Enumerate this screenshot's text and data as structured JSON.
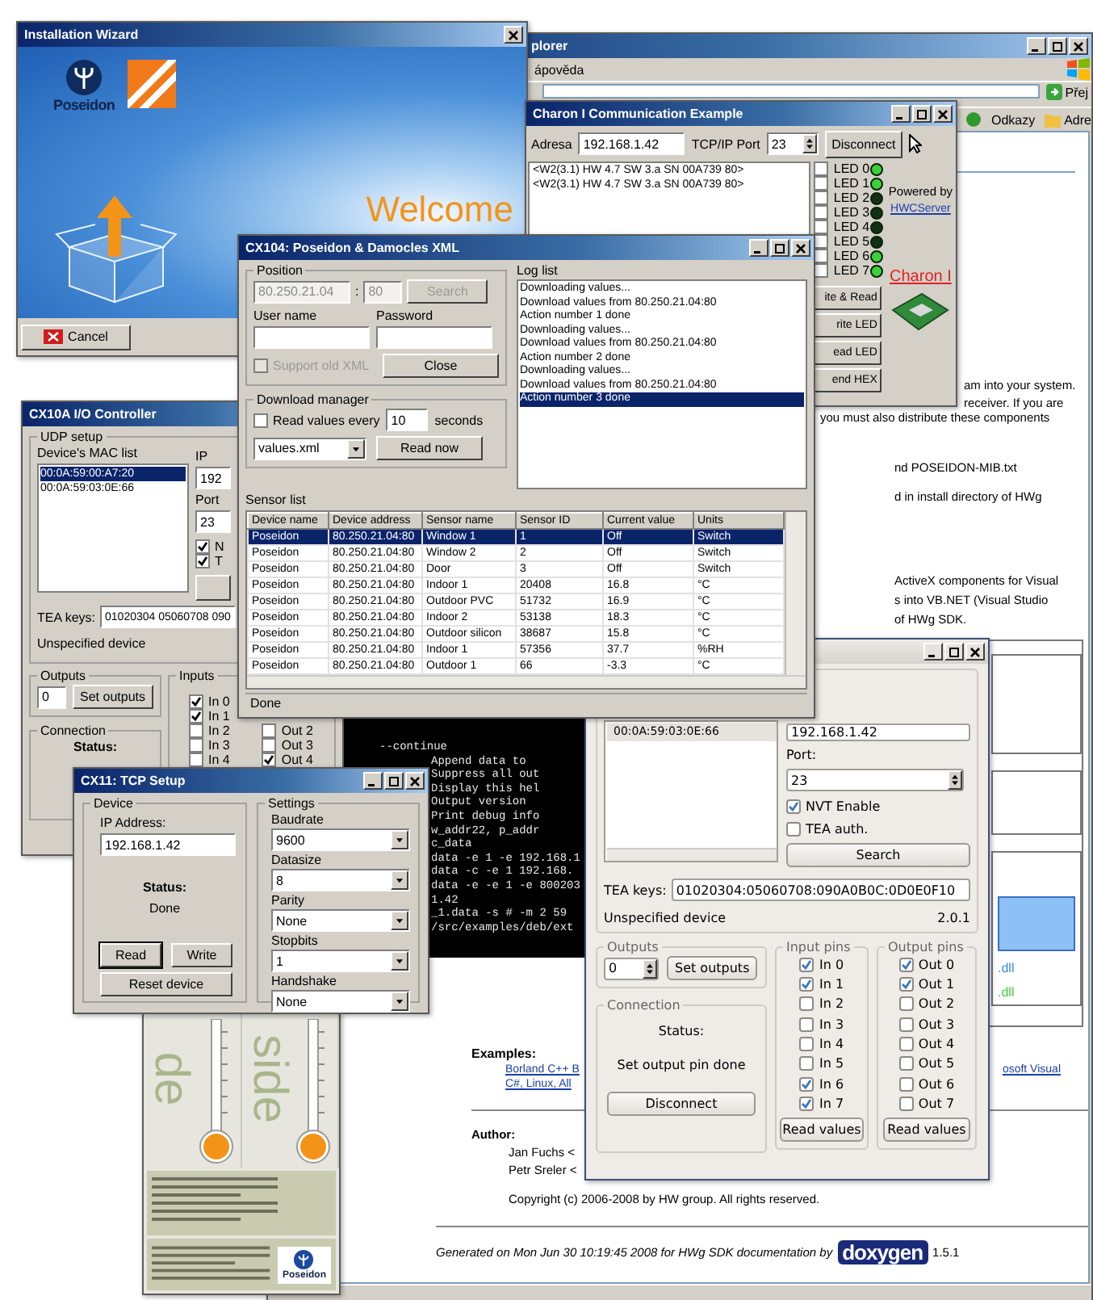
{
  "browser": {
    "title": "plorer",
    "menu": "ápověda",
    "go": "Přej",
    "links_label": "Odkazy",
    "address_label": "Adre",
    "fragments": [
      "am into your system.",
      "receiver. If you are",
      "you must also distribute these components",
      "nd POSEIDON-MIB.txt",
      "d in install directory of HWg",
      "ActiveX components for Visual",
      "s into VB.NET (Visual Studio",
      "of HWg SDK."
    ],
    "dll_labels": [
      {
        "text": ".dll",
        "color": "#3a8ee6"
      },
      {
        "text": ".dll",
        "color": "#3fcf3f"
      }
    ],
    "examples_heading": "Examples:",
    "example_links": [
      "Borland C++ B",
      "osoft Visual",
      "C#, Linux, All"
    ],
    "author_heading": "Author:",
    "authors": [
      "Jan Fuchs <",
      "Petr Sreler <"
    ],
    "copyright": "Copyright (c) 2006-2008 by HW group. All rights reserved.",
    "generated": "Generated on Mon Jun 30 10:19:45 2008 for HWg SDK documentation by",
    "doxygen": "doxygen",
    "doxygen_version": "1.5.1"
  },
  "terminal": {
    "lines": [
      "--continue",
      "Append data to",
      "Suppress all out",
      "Display this hel",
      "Output version",
      "Print debug info",
      "w_addr22, p_addr",
      "c_data",
      "data -e 1 -e 192.168.1",
      "data -c -e 1 192.168.",
      "data -e -e 1 -e 800203",
      "1.42",
      "_1.data -s # -m 2 59",
      "/src/examples/deb/ext"
    ]
  },
  "wizard": {
    "title": "Installation Wizard",
    "brand": "Poseidon",
    "welcome": "Welcome",
    "cancel": "Cancel"
  },
  "charon": {
    "title": "Charon I Communication Example",
    "address_label": "Adresa",
    "address": "192.168.1.42",
    "port_label": "TCP/IP Port",
    "port": "23",
    "disconnect": "Disconnect",
    "log": [
      "<W2(3.1) HW 4.7 SW 3.a SN 00A739 80>",
      "<W2(3.1) HW 4.7 SW 3.a SN 00A739 80>"
    ],
    "leds": [
      {
        "label": "LED 0",
        "checked": false,
        "on": true
      },
      {
        "label": "LED 1",
        "checked": false,
        "on": true
      },
      {
        "label": "LED 2",
        "checked": false,
        "on": false
      },
      {
        "label": "LED 3",
        "checked": false,
        "on": false
      },
      {
        "label": "LED 4",
        "checked": false,
        "on": false
      },
      {
        "label": "LED 5",
        "checked": false,
        "on": false
      },
      {
        "label": "LED 6",
        "checked": false,
        "on": true
      },
      {
        "label": "LED 7",
        "checked": false,
        "on": true
      }
    ],
    "actions": [
      "ite & Read",
      "rite LED",
      "ead LED",
      "end HEX"
    ],
    "powered_by": "Powered by",
    "server_link": "HWCServer",
    "product": "Charon I"
  },
  "io": {
    "title": "CX10A I/O Controller",
    "udp_label": "UDP setup",
    "mac_label": "Device's MAC list",
    "macs": [
      {
        "text": "00:0A:59:00:A7:20",
        "selected": true
      },
      {
        "text": "00:0A:59:03:0E:66",
        "selected": false
      }
    ],
    "ip_label": "IP",
    "ip": "192",
    "port_label": "Port",
    "port": "23",
    "options": [
      {
        "label": "N",
        "checked": true
      },
      {
        "label": "T",
        "checked": true
      }
    ],
    "tea_label": "TEA keys:",
    "tea": "01020304 05060708 090",
    "device": "Unspecified device",
    "outputs_label": "Outputs",
    "outputs": "0",
    "set_outputs": "Set outputs",
    "inputs_label": "Inputs",
    "inputs": [
      {
        "label": "In 0",
        "checked": true
      },
      {
        "label": "In 1",
        "checked": true
      },
      {
        "label": "In 2",
        "checked": false
      },
      {
        "label": "In 3",
        "checked": false
      },
      {
        "label": "In 4",
        "checked": false
      }
    ],
    "outs": [
      {
        "label": "Out 2",
        "checked": false
      },
      {
        "label": "Out 3",
        "checked": false
      },
      {
        "label": "Out 4",
        "checked": true
      }
    ],
    "connection_label": "Connection",
    "status_label": "Status:"
  },
  "qt": {
    "mac": {
      "text": "00:0A:59:03:0E:66",
      "selected": true
    },
    "ip": "192.168.1.42",
    "port_label": "Port:",
    "port": "23",
    "options": [
      {
        "label": "NVT Enable",
        "checked": true
      },
      {
        "label": "TEA auth.",
        "checked": false
      }
    ],
    "search": "Search",
    "tea_label": "TEA keys:",
    "tea": "01020304:05060708:090A0B0C:0D0E0F10",
    "device": "Unspecified device",
    "version": "2.0.1",
    "outputs_label": "Outputs",
    "outputs": "0",
    "set_outputs": "Set outputs",
    "connection_label": "Connection",
    "status_label": "Status:",
    "status": "Set output pin done",
    "disconnect": "Disconnect",
    "input_label": "Input pins",
    "inputs": [
      {
        "label": "In 0",
        "checked": true
      },
      {
        "label": "In 1",
        "checked": true
      },
      {
        "label": "In 2",
        "checked": false
      },
      {
        "label": "In 3",
        "checked": false
      },
      {
        "label": "In 4",
        "checked": false
      },
      {
        "label": "In 5",
        "checked": false
      },
      {
        "label": "In 6",
        "checked": true
      },
      {
        "label": "In 7",
        "checked": true
      }
    ],
    "input_read": "Read values",
    "output_label": "Output pins",
    "output_pins": [
      {
        "label": "Out 0",
        "checked": true
      },
      {
        "label": "Out 1",
        "checked": true
      },
      {
        "label": "Out 2",
        "checked": false
      },
      {
        "label": "Out 3",
        "checked": false
      },
      {
        "label": "Out 4",
        "checked": false
      },
      {
        "label": "Out 5",
        "checked": false
      },
      {
        "label": "Out 6",
        "checked": false
      },
      {
        "label": "Out 7",
        "checked": false
      }
    ],
    "output_read": "Read values"
  },
  "thermometer": {
    "labels": [
      "de",
      "side"
    ],
    "brand": "Poseidon"
  },
  "tcp": {
    "title": "CX11: TCP Setup",
    "device_label": "Device",
    "ip_label": "IP Address:",
    "ip": "192.168.1.42",
    "status_label": "Status:",
    "status": "Done",
    "read": "Read",
    "write": "Write",
    "reset": "Reset device",
    "settings_label": "Settings",
    "settings": [
      {
        "label": "Baudrate",
        "value": "9600"
      },
      {
        "label": "Datasize",
        "value": "8"
      },
      {
        "label": "Parity",
        "value": "None"
      },
      {
        "label": "Stopbits",
        "value": "1"
      },
      {
        "label": "Handshake",
        "value": "None"
      }
    ]
  },
  "xml": {
    "title": "CX104: Poseidon & Damocles XML",
    "position_label": "Position",
    "host": {
      "value": "80.250.21.04",
      "disabled": true
    },
    "separator": ":",
    "port": {
      "value": "80",
      "disabled": true
    },
    "search": {
      "label": "Search",
      "disabled": true
    },
    "user_label": "User name",
    "password_label": "Password",
    "old_xml": {
      "label": "Support old XML",
      "checked": false,
      "disabled": true
    },
    "close": "Close",
    "download_label": "Download manager",
    "read_every": {
      "label": "Read values every",
      "checked": false
    },
    "interval": "10",
    "seconds": "seconds",
    "file": "values.xml",
    "read_now": "Read now",
    "log_label": "Log list",
    "log": [
      {
        "text": "Downloading values...",
        "selected": false
      },
      {
        "text": "Download values from 80.250.21.04:80",
        "selected": false
      },
      {
        "text": "Action number 1 done",
        "selected": false
      },
      {
        "text": "Downloading values...",
        "selected": false
      },
      {
        "text": "Download values from 80.250.21.04:80",
        "selected": false
      },
      {
        "text": "Action number 2 done",
        "selected": false
      },
      {
        "text": "Downloading values...",
        "selected": false
      },
      {
        "text": "Download values from 80.250.21.04:80",
        "selected": false
      },
      {
        "text": "Action number 3 done",
        "selected": true
      }
    ],
    "sensor_label": "Sensor list",
    "columns": [
      "Device name",
      "Device address",
      "Sensor name",
      "Sensor ID",
      "Current value",
      "Units"
    ],
    "rows": [
      {
        "cells": [
          "Poseidon",
          "80.250.21.04:80",
          "Window 1",
          "1",
          "Off",
          "Switch"
        ],
        "selected": true
      },
      {
        "cells": [
          "Poseidon",
          "80.250.21.04:80",
          "Window 2",
          "2",
          "Off",
          "Switch"
        ],
        "selected": false
      },
      {
        "cells": [
          "Poseidon",
          "80.250.21.04:80",
          "Door",
          "3",
          "Off",
          "Switch"
        ],
        "selected": false
      },
      {
        "cells": [
          "Poseidon",
          "80.250.21.04:80",
          "Indoor 1",
          "20408",
          "16.8",
          "°C"
        ],
        "selected": false
      },
      {
        "cells": [
          "Poseidon",
          "80.250.21.04:80",
          "Outdoor PVC",
          "51732",
          "16.9",
          "°C"
        ],
        "selected": false
      },
      {
        "cells": [
          "Poseidon",
          "80.250.21.04:80",
          "Indoor 2",
          "53138",
          "18.3",
          "°C"
        ],
        "selected": false
      },
      {
        "cells": [
          "Poseidon",
          "80.250.21.04:80",
          "Outdoor silicon",
          "38687",
          "15.8",
          "°C"
        ],
        "selected": false
      },
      {
        "cells": [
          "Poseidon",
          "80.250.21.04:80",
          "Indoor 1",
          "57356",
          "37.7",
          "%RH"
        ],
        "selected": false
      },
      {
        "cells": [
          "Poseidon",
          "80.250.21.04:80",
          "Outdoor 1",
          "66",
          "-3.3",
          "°C"
        ],
        "selected": false
      }
    ],
    "status": "Done"
  }
}
